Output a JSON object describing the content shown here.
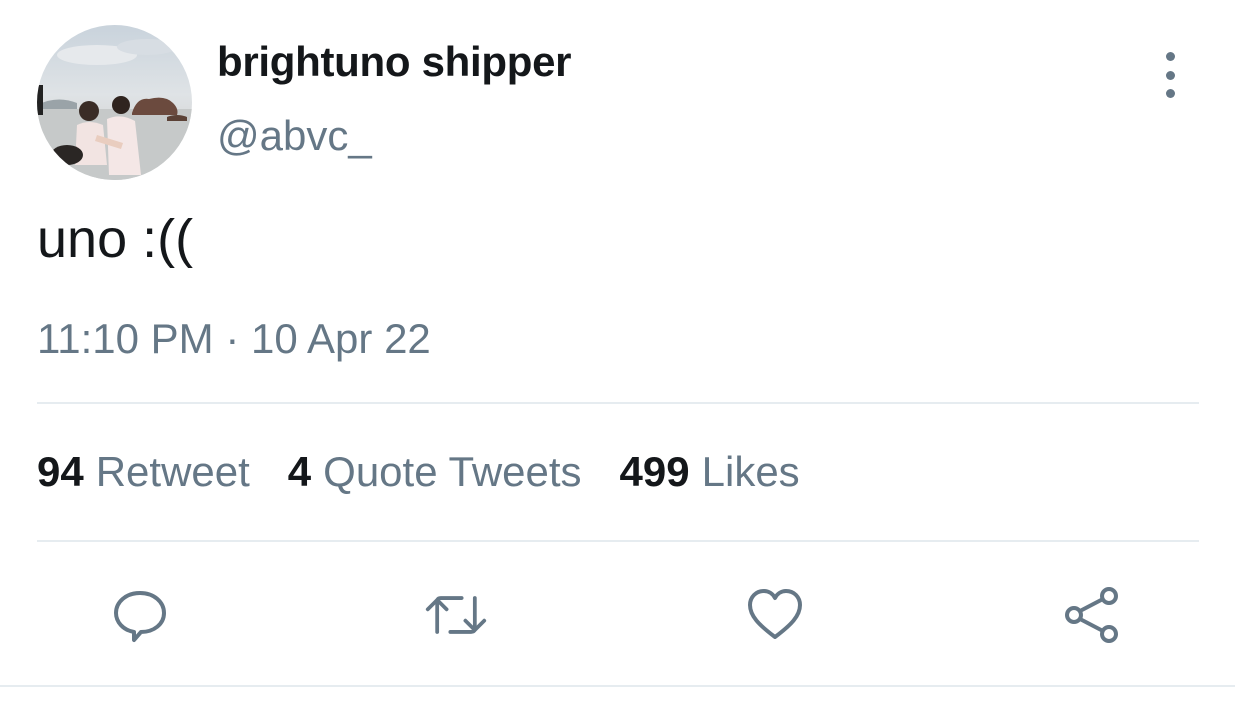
{
  "user": {
    "display_name": "brightuno shipper",
    "handle": "@abvc_",
    "avatar": "avatar-photo-beach"
  },
  "tweet": {
    "text": "uno :((",
    "timestamp": "11:10 PM · 10 Apr 22"
  },
  "stats": {
    "retweets_count": "94",
    "retweets_label": "Retweet",
    "quotes_count": "4",
    "quotes_label": "Quote Tweets",
    "likes_count": "499",
    "likes_label": "Likes"
  },
  "actions": {
    "reply_icon": "reply-icon",
    "retweet_icon": "retweet-icon",
    "like_icon": "heart-icon",
    "share_icon": "share-icon",
    "more_icon": "more-vertical-icon"
  },
  "colors": {
    "text_primary": "#14171a",
    "text_secondary": "#657786",
    "divider": "#e6ecf0"
  }
}
